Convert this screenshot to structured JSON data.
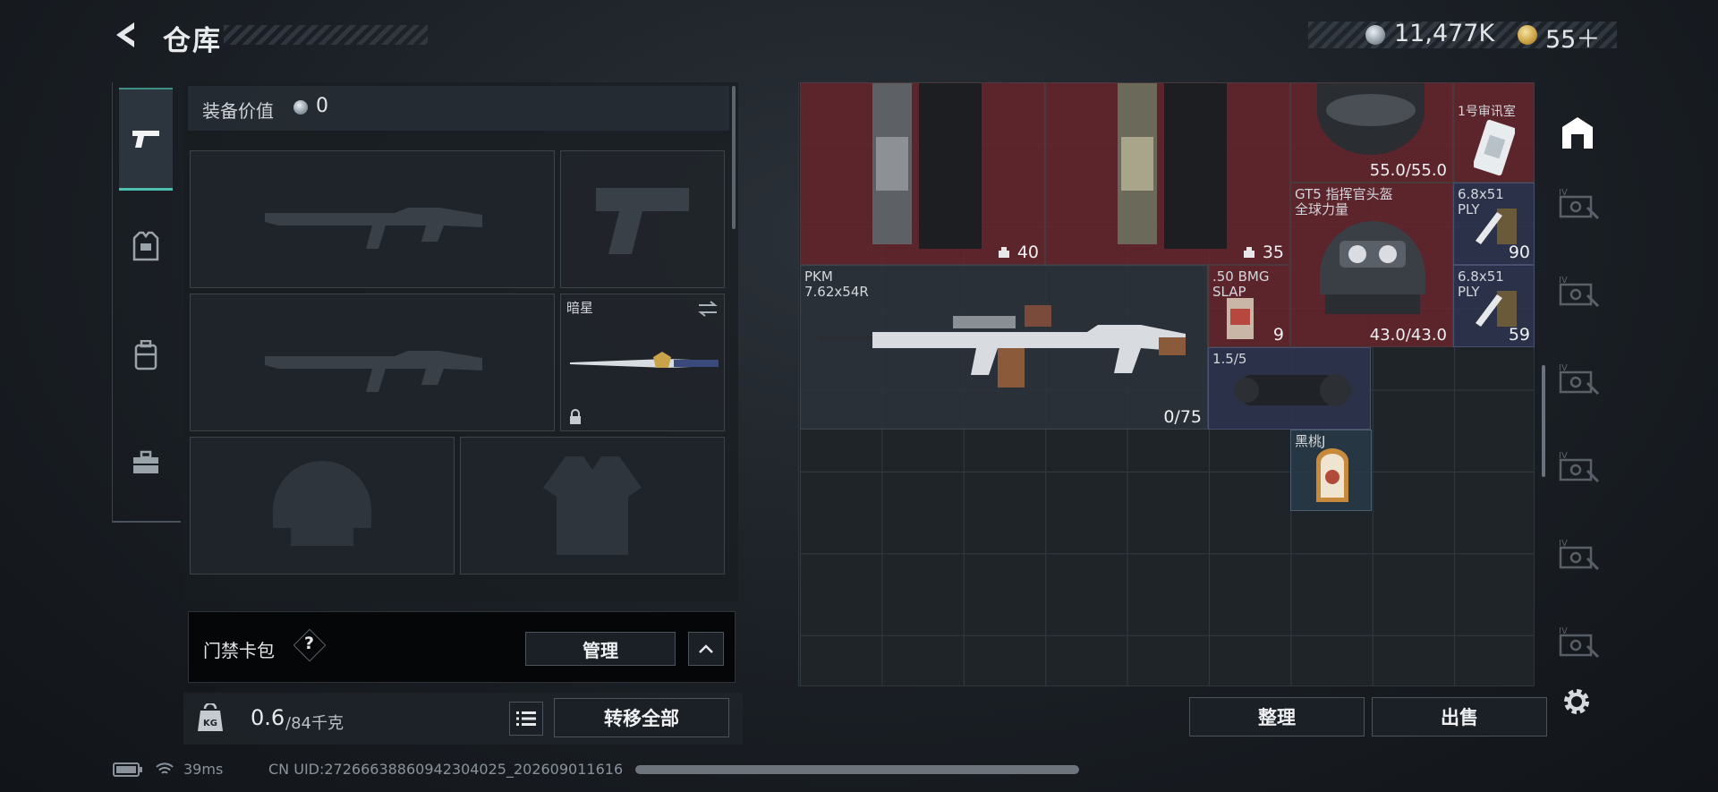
{
  "header": {
    "title": "仓库",
    "currency_silver": "11,477K",
    "currency_gold": "55＋"
  },
  "tabs": [
    {
      "name": "weapon",
      "icon": "pistol-icon",
      "active": true
    },
    {
      "name": "armor",
      "icon": "vest-icon",
      "active": false
    },
    {
      "name": "backpack",
      "icon": "backpack-icon",
      "active": false
    },
    {
      "name": "toolbox",
      "icon": "toolbox-icon",
      "active": false
    }
  ],
  "equipment": {
    "value_label": "装备价值",
    "value": "0",
    "melee_name": "暗星"
  },
  "keycard": {
    "label": "门禁卡包",
    "help": "?",
    "manage_button": "管理"
  },
  "weight": {
    "current": "0.6",
    "max": "/84千克",
    "transfer_button": "转移全部"
  },
  "grid_items": {
    "rig1_count": "40",
    "rig2_count": "35",
    "helmet1_label": "",
    "helmet1_durability": "55.0/55.0",
    "keycard_label": "1号审讯室",
    "helmet2_label": "GT5 指挥官头盔",
    "helmet2_sub": "全球力量",
    "ammo1_label": "6.8x51",
    "ammo1_sub": "PLY",
    "ammo1_count": "90",
    "gun_name": "PKM",
    "gun_caliber": "7.62x54R",
    "gun_ammo": "0/75",
    "bmg_label": ".50 BMG",
    "bmg_sub": "SLAP",
    "bmg_count": "9",
    "helmet2_durability": "43.0/43.0",
    "ammo2_label": "6.8x51",
    "ammo2_sub": "PLY",
    "ammo2_count": "59",
    "scope_label": "1.5/5",
    "charm_label": "黑桃J"
  },
  "actions": {
    "sort_button": "整理",
    "sell_button": "出售"
  },
  "status": {
    "ping": "39ms",
    "uid": "CN UID:27266638860942304025_202609011616"
  },
  "colors": {
    "accent_teal": "#4dbfae",
    "item_red": "#6e242c",
    "item_navy": "#2e344e"
  }
}
